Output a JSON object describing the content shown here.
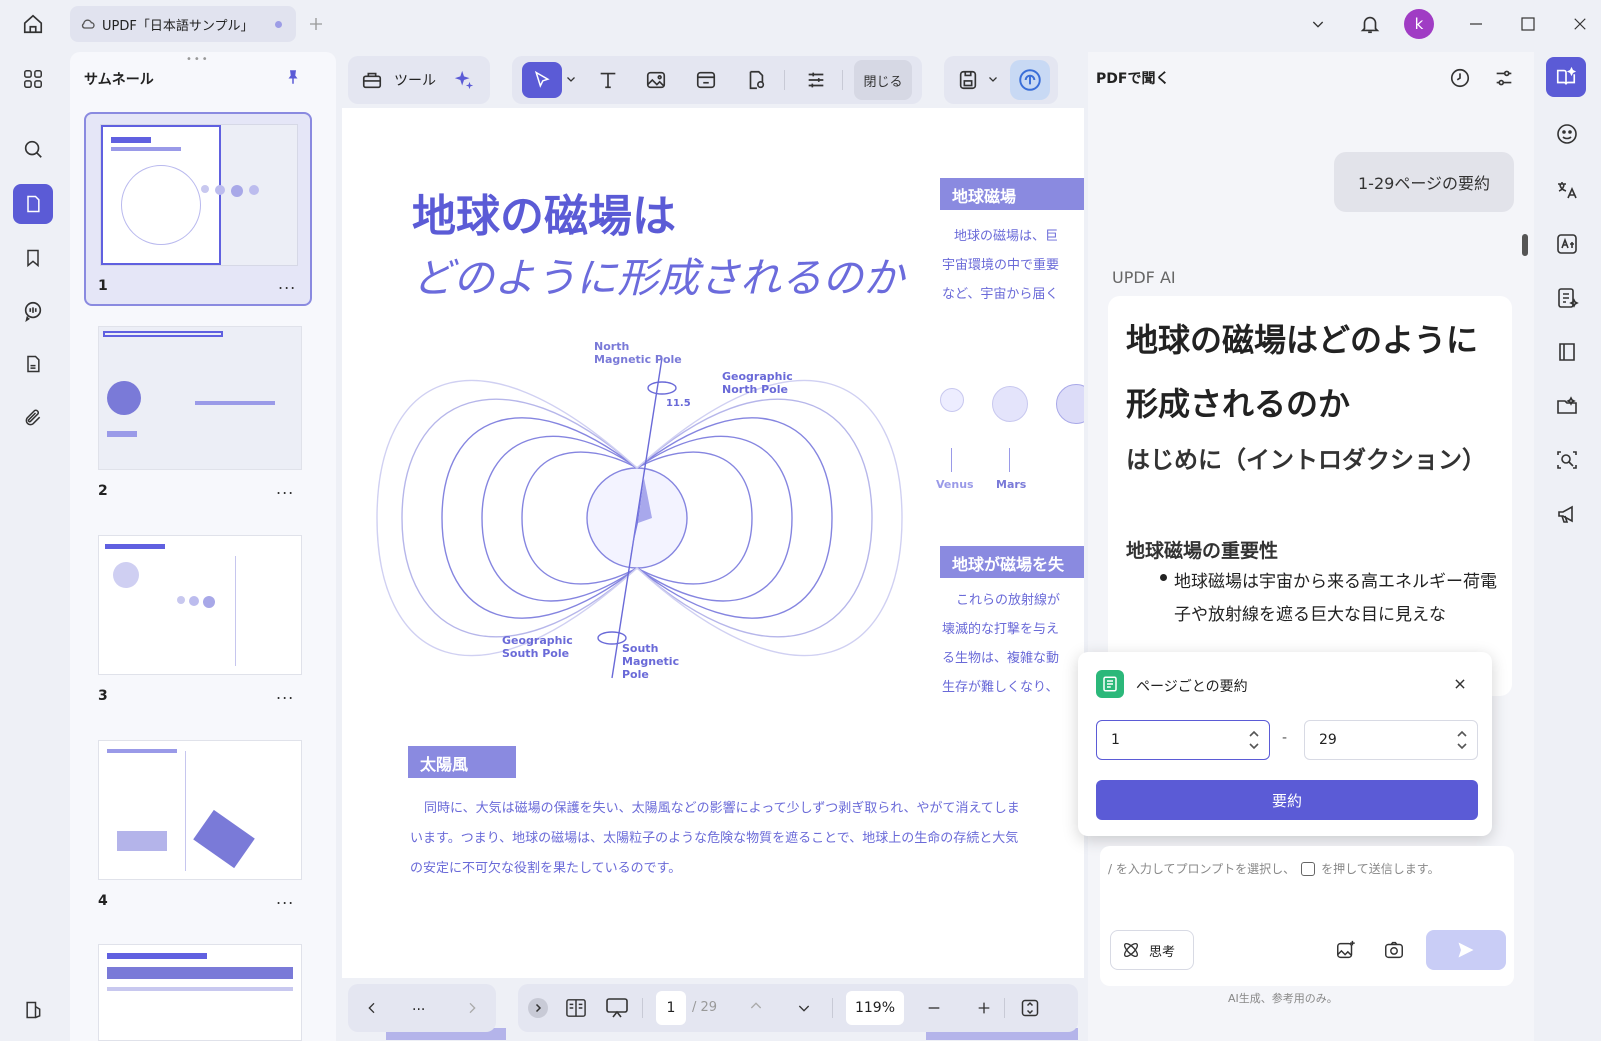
{
  "window": {
    "tab_title": "UPDF「日本語サンプル」",
    "avatar_letter": "k"
  },
  "thumbnails": {
    "title": "サムネール",
    "items": [
      {
        "num": "1"
      },
      {
        "num": "2"
      },
      {
        "num": "3"
      },
      {
        "num": "4"
      }
    ],
    "more": "..."
  },
  "toolbar": {
    "tools_label": "ツール",
    "close_label": "閉じる"
  },
  "document": {
    "title_line1": "地球の磁場は",
    "title_line2": "どのように形成されるのか",
    "diagram_labels": {
      "north_magnetic": "North\nMagnetic Pole",
      "geo_north": "Geographic\nNorth Pole",
      "angle": "11.5",
      "geo_south": "Geographic\nSouth Pole",
      "south_magnetic": "South\nMagnetic\nPole"
    },
    "side_heading1": "地球磁場",
    "side_text1": [
      "地球の磁場は、巨",
      "宇宙環境の中で重要",
      "など、宇宙から届く"
    ],
    "planet_labels": [
      "Venus",
      "Mars"
    ],
    "side_heading2": "地球が磁場を失",
    "side_text2": [
      "これらの放射線が",
      "壊滅的な打撃を与え",
      "る生物は、複雑な動",
      "生存が難しくなり、"
    ],
    "section_heading": "太陽風",
    "section_body": [
      "同時に、大気は磁場の保護を失い、太陽風などの影響によって少しずつ剥ぎ取られ、やがて消えてしま",
      "います。つまり、地球の磁場は、太陽粒子のような危険な物質を遮ることで、地球上の生命の存続と大気",
      "の安定に不可欠な役割を果たしているのです。"
    ]
  },
  "pager": {
    "dots": "...",
    "current_page": "1",
    "total": "/ 29",
    "zoom": "119%"
  },
  "ai_panel": {
    "title": "PDFで聞く",
    "user_message": "1-29ページの要約",
    "ai_label": "UPDF AI",
    "response_h1": "地球の磁場はどのように形成されるのか",
    "response_h2": "はじめに（イントロダクション）",
    "response_h3": "地球磁場の重要性",
    "response_bullet": "地球磁場は宇宙から来る高エネルギー荷電子や放射線を遮る巨大な目に見えな",
    "popup_title": "ページごとの要約",
    "range_from": "1",
    "range_to": "29",
    "range_sep": "-",
    "summarize_label": "要約",
    "prompt_hint_a": "/ を入力してプロンプトを選択し、",
    "prompt_hint_b": "を押して送信します。",
    "think_label": "思考",
    "footer": "AI生成、参考用のみ。"
  },
  "colors": {
    "accent": "#5b5bd6",
    "avatar": "#a03cc4",
    "tag_bg": "#8a8ae0"
  }
}
